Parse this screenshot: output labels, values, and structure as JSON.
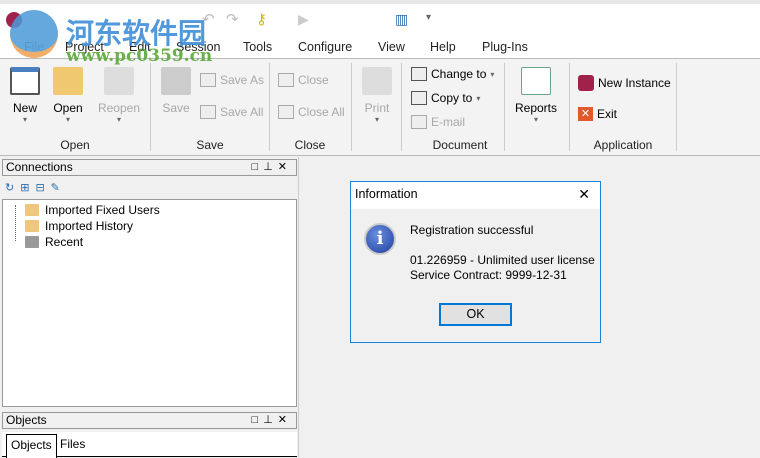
{
  "watermark": {
    "title": "河东软件园",
    "url": "www.pc0359.cn"
  },
  "menu": [
    "File",
    "Project",
    "Edit",
    "Session",
    "Tools",
    "Configure",
    "View",
    "Help",
    "Plug-Ins"
  ],
  "ribbon": {
    "open_group": {
      "label": "Open",
      "new": "New",
      "open": "Open",
      "reopen": "Reopen"
    },
    "save_group": {
      "label": "Save",
      "save": "Save",
      "save_as": "Save As",
      "save_all": "Save All"
    },
    "close_group": {
      "label": "Close",
      "close": "Close",
      "close_all": "Close All"
    },
    "document_group": {
      "label": "Document",
      "print": "Print",
      "change_to": "Change to",
      "copy_to": "Copy to",
      "email": "E-mail",
      "reports": "Reports"
    },
    "application_group": {
      "label": "Application",
      "new_instance": "New Instance",
      "exit": "Exit"
    }
  },
  "connections": {
    "title": "Connections",
    "items": [
      "Imported Fixed Users",
      "Imported History",
      "Recent"
    ]
  },
  "objects": {
    "title": "Objects",
    "tabs": [
      "Objects",
      "Files"
    ]
  },
  "dialog": {
    "title": "Information",
    "message": "Registration successful",
    "license": "01.226959 - Unlimited user license",
    "contract": "Service Contract: 9999-12-31",
    "ok": "OK"
  },
  "colors": {
    "accent": "#0078d7",
    "folder": "#efc67d"
  }
}
